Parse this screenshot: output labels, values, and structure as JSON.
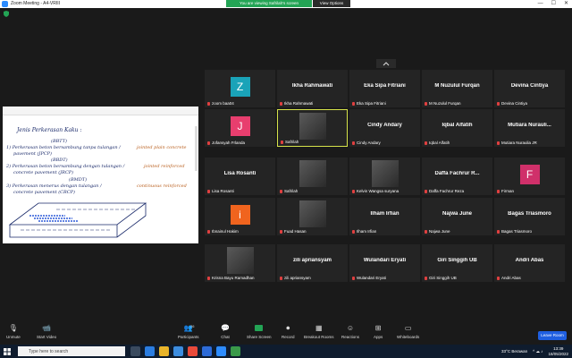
{
  "window": {
    "title": "Zoom Meeting - A4-VRIII"
  },
  "share_banner": {
    "viewing": "You are viewing Safrilah's screen",
    "view_options": "View Options"
  },
  "whiteboard": {
    "lines": [
      "Jenis Perkerasan Kaku :",
      "1) Perkerasan beton bersambung tanpa tulangan / ",
      "pavement (JPCP)",
      "2) Perkerasan beton bersambung dengan tulangan / ",
      "concrete pavement (JRCP)",
      "3) Perkerasan menerus dengan tulangan / ",
      "concrete pavement (CRCP)",
      "jointed plain concrete",
      "jointed reinforced",
      "continuous reinforced",
      "(BBTT)",
      "(BBDT)",
      "(BMDT)"
    ]
  },
  "grid": {
    "tiles": [
      {
        "name": "",
        "label": "zoom baa04",
        "avatar": "Z",
        "avatar_color": "#1aa3b8"
      },
      {
        "name": "Ikha Rahmawati",
        "label": "Ikha Rahmawati"
      },
      {
        "name": "Eka Sipa Fitriani",
        "label": "Eka Sipa Fitriani"
      },
      {
        "name": "M Nuzulul Furqan",
        "label": "M Nuzulul Furqan"
      },
      {
        "name": "Devina Cintiya",
        "label": "Devina Cintiya"
      },
      {
        "name": "",
        "label": "Jofansyah Frlanda",
        "avatar": "J",
        "avatar_color": "#e83e6e"
      },
      {
        "name": "",
        "label": "Safrilah",
        "photo": true
      },
      {
        "name": "Cindy Andary",
        "label": "Cindy Andary"
      },
      {
        "name": "Iqbal Alfatih",
        "label": "Iqbal Alfatih"
      },
      {
        "name": "Mutiara Nurauli...",
        "label": "Mutiara Nuraulia JR"
      },
      {
        "name": "Lisa Rosanti",
        "label": "Lisa Rosanti"
      },
      {
        "name": "",
        "label": "Safrilah",
        "photo": true
      },
      {
        "name": "",
        "label": "Kelvin Wangsa suryana",
        "photo": true
      },
      {
        "name": "Daffa Fachrur R...",
        "label": "Daffa Fachrur Reza"
      },
      {
        "name": "",
        "label": "Firman",
        "avatar": "F",
        "avatar_color": "#d0306a"
      },
      {
        "name": "",
        "label": "Ibnainul Hakim",
        "avatar": "i",
        "avatar_color": "#f0641e"
      },
      {
        "name": "",
        "label": "Fuad Hasan",
        "photo": true
      },
      {
        "name": "Ilham Irfian",
        "label": "Ilham Irfian"
      },
      {
        "name": "Najwa June",
        "label": "Najwa June"
      },
      {
        "name": "Bagas Triasmoro",
        "label": "Bagas Triasmoro"
      },
      {
        "name": "",
        "label": "Krisna Bayu Ramadhan",
        "photo": true
      },
      {
        "name": "zili apriansyam",
        "label": "zili apriansyam"
      },
      {
        "name": "Wulandari Eryati",
        "label": "Wulandari Eryati"
      },
      {
        "name": "Giri Singgih UB",
        "label": "Giri Singgih UB"
      },
      {
        "name": "Andri Abas",
        "label": "Andri Abas"
      }
    ]
  },
  "toolbar": {
    "unmute": "Unmute",
    "start_video": "Start Video",
    "participants": "Participants",
    "participants_count": "26",
    "chat": "Chat",
    "share_screen": "Share Screen",
    "record": "Record",
    "breakout": "Breakout Rooms",
    "reactions": "Reactions",
    "apps": "Apps",
    "whiteboards": "Whiteboards",
    "leave": "Leave Room"
  },
  "taskbar": {
    "search_placeholder": "Type here to search",
    "weather": "33°C  Berawan",
    "time": "13:39",
    "date": "18/05/2022"
  }
}
